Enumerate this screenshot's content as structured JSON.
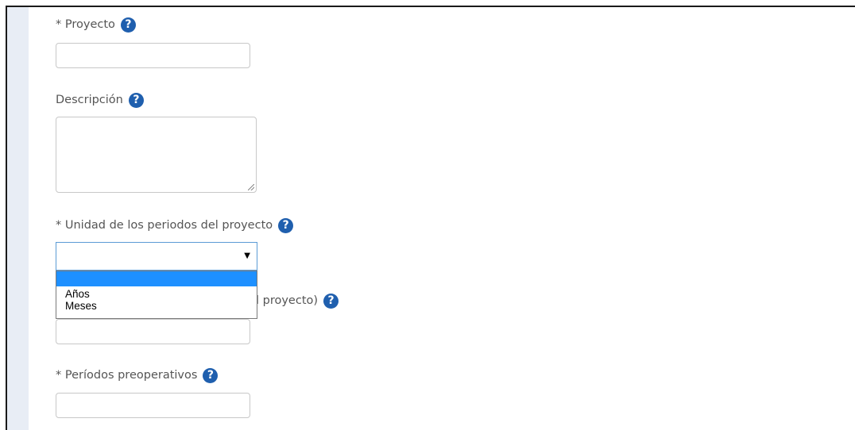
{
  "form": {
    "proyecto": {
      "label": "* Proyecto",
      "value": ""
    },
    "descripcion": {
      "label": "Descripción",
      "value": ""
    },
    "unidad": {
      "label": "* Unidad de los periodos del proyecto",
      "selected": "",
      "options": [
        "",
        "Años",
        "Meses"
      ]
    },
    "duracion": {
      "label_visible": "l proyecto)",
      "value": ""
    },
    "preoperativos": {
      "label": "* Períodos preoperativos",
      "value": ""
    }
  },
  "icons": {
    "help": "question-circle-icon",
    "help_color": "#1f5fae"
  },
  "colors": {
    "gutter": "#e8edf5",
    "dropdown_highlight": "#1e90ff",
    "select_focus": "#5b9bd5"
  }
}
